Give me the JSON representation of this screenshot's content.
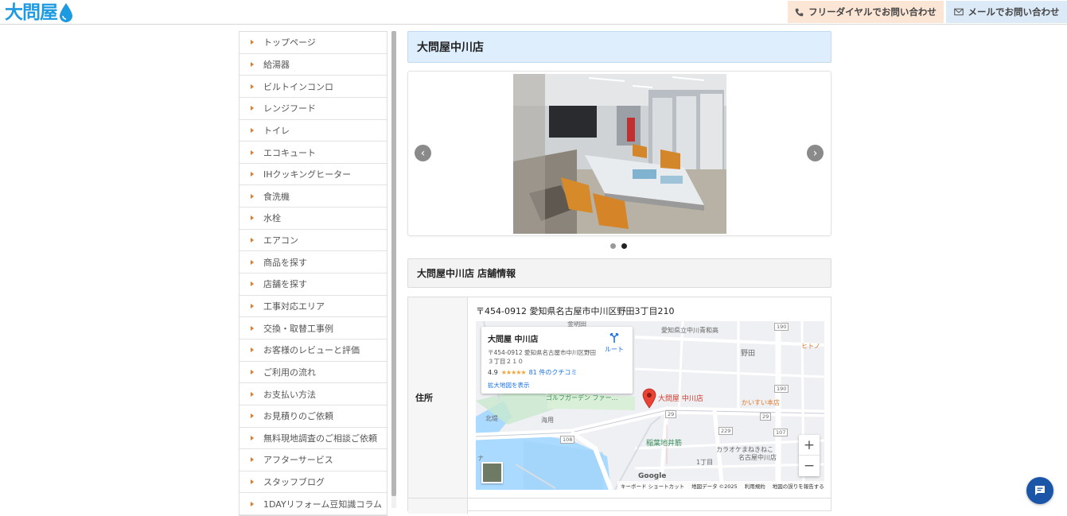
{
  "header": {
    "logo_text": "大問屋",
    "tel_label": "フリーダイヤルでお問い合わせ",
    "mail_label": "メールでお問い合わせ"
  },
  "sidebar": {
    "items": [
      {
        "label": "トップページ"
      },
      {
        "label": "給湯器"
      },
      {
        "label": "ビルトインコンロ"
      },
      {
        "label": "レンジフード"
      },
      {
        "label": "トイレ"
      },
      {
        "label": "エコキュート"
      },
      {
        "label": "IHクッキングヒーター"
      },
      {
        "label": "食洗機"
      },
      {
        "label": "水栓"
      },
      {
        "label": "エアコン"
      },
      {
        "label": "商品を探す"
      },
      {
        "label": "店舗を探す"
      },
      {
        "label": "工事対応エリア"
      },
      {
        "label": "交換・取替工事例"
      },
      {
        "label": "お客様のレビューと評価"
      },
      {
        "label": "ご利用の流れ"
      },
      {
        "label": "お支払い方法"
      },
      {
        "label": "お見積りのご依頼"
      },
      {
        "label": "無料現地調査のご相談ご依頼"
      },
      {
        "label": "アフターサービス"
      },
      {
        "label": "スタッフブログ"
      },
      {
        "label": "1DAYリフォーム豆知識コラム"
      }
    ]
  },
  "main": {
    "page_title": "大問屋中川店",
    "slider": {
      "slide_count": 2,
      "active_index": 1
    },
    "section_title": "大問屋中川店 店舗情報",
    "info": {
      "address_label": "住所",
      "address_value": "〒454-0912 愛知県名古屋市中川区野田3丁目210"
    },
    "map": {
      "card_name": "大問屋 中川店",
      "card_address": "〒454-0912 愛知県名古屋市中川区野田３丁目２１０",
      "route_label": "ルート",
      "rating": "4.9",
      "stars": "★★★★★",
      "reviews": "81 件のクチコミ",
      "view_larger": "拡大地図を表示",
      "pin_label": "大問屋 中川店",
      "labels": {
        "school": "愛知県立中川青和高",
        "noda": "野田",
        "golf": "ゴルフガーデン ファー…",
        "kaisui": "かいすい本店",
        "inaba": "稲葉地井筋",
        "karaoke": "カラオケまねきねこ",
        "karaoke2": "名古屋中川店",
        "hokutei": "北堤",
        "kaiyo": "海用",
        "itchome": "1丁目",
        "hito": "ヒトノ",
        "shin": "金明田",
        "na": "ナ"
      },
      "roads": [
        "190",
        "29",
        "229",
        "107",
        "108",
        "29",
        "190"
      ],
      "google": "Google",
      "footer_shortcuts": "キーボード ショートカット",
      "footer_data": "地図データ ©2025",
      "footer_terms": "利用規約",
      "footer_report": "地図の誤りを報告する"
    }
  }
}
